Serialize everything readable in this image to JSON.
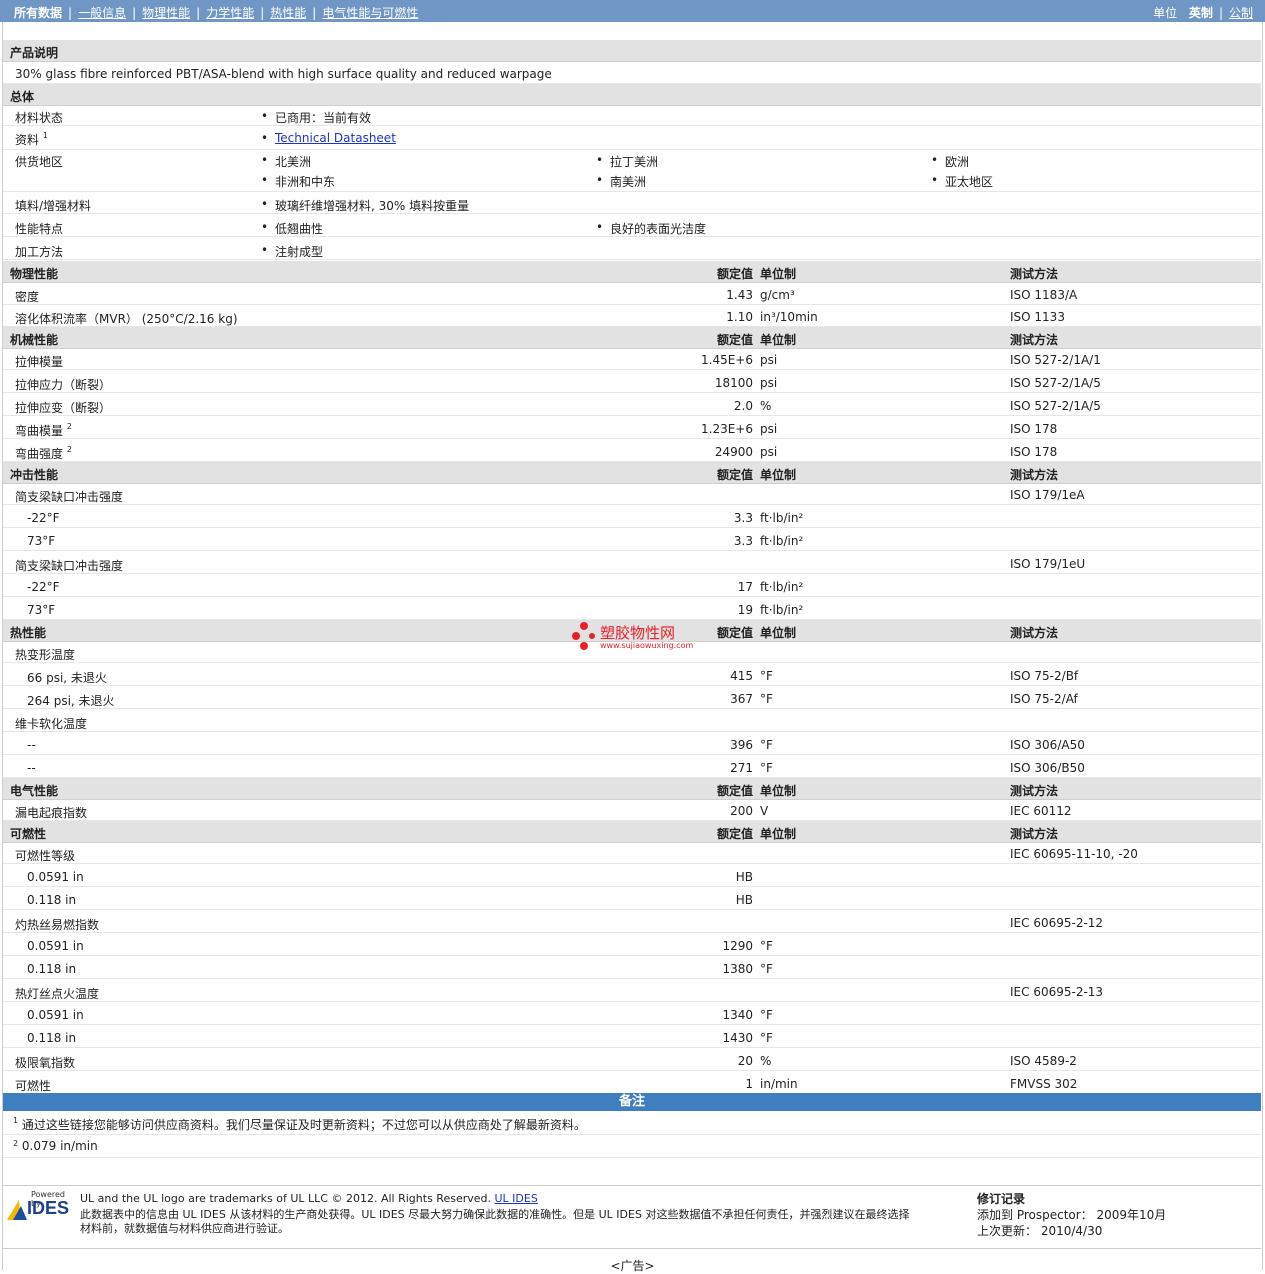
{
  "nav": {
    "items": [
      "所有数据",
      "一般信息",
      "物理性能",
      "力学性能",
      "热性能",
      "电气性能与可燃性"
    ],
    "unit_label": "单位",
    "unit_imperial": "英制",
    "unit_metric": "公制"
  },
  "desc": {
    "title": "产品说明",
    "text": "30% glass fibre reinforced PBT/ASA-blend with high surface quality and reduced warpage"
  },
  "general": {
    "title": "总体",
    "material_status_label": "材料状态",
    "material_status": "已商用：当前有效",
    "resource_label": "资料",
    "resource_sup": "1",
    "resource_link": "Technical Datasheet",
    "regions_label": "供货地区",
    "regions": [
      "北美洲",
      "拉丁美洲",
      "欧洲",
      "非洲和中东",
      "南美洲",
      "亚太地区"
    ],
    "filler_label": "填料/增强材料",
    "filler": "玻璃纤维增强材料, 30% 填料按重量",
    "features_label": "性能特点",
    "features": [
      "低翘曲性",
      "良好的表面光洁度"
    ],
    "processing_label": "加工方法",
    "processing": "注射成型"
  },
  "col": {
    "value": "额定值",
    "unit": "单位制",
    "method": "测试方法"
  },
  "sections": {
    "physical": "物理性能",
    "mechanical": "机械性能",
    "impact": "冲击性能",
    "thermal": "热性能",
    "electrical": "电气性能",
    "flammability": "可燃性"
  },
  "rows": {
    "density": {
      "name": "密度",
      "value": "1.43",
      "unit": "g/cm³",
      "method": "ISO 1183/A"
    },
    "mvr": {
      "name": "溶化体积流率（MVR） (250°C/2.16 kg)",
      "value": "1.10",
      "unit": "in³/10min",
      "method": "ISO 1133"
    },
    "tmod": {
      "name": "拉伸模量",
      "value": "1.45E+6",
      "unit": "psi",
      "method": "ISO 527-2/1A/1"
    },
    "tstress": {
      "name": "拉伸应力（断裂）",
      "value": "18100",
      "unit": "psi",
      "method": "ISO 527-2/1A/5"
    },
    "tstrain": {
      "name": "拉伸应变（断裂）",
      "value": "2.0",
      "unit": "%",
      "method": "ISO 527-2/1A/5"
    },
    "fmod": {
      "name": "弯曲模量",
      "sup": "2",
      "value": "1.23E+6",
      "unit": "psi",
      "method": "ISO 178"
    },
    "fstr": {
      "name": "弯曲强度",
      "sup": "2",
      "value": "24900",
      "unit": "psi",
      "method": "ISO 178"
    },
    "charpy1": {
      "name": "简支梁缺口冲击强度",
      "method": "ISO 179/1eA"
    },
    "c1a": {
      "name": "-22°F",
      "value": "3.3",
      "unit": "ft·lb/in²"
    },
    "c1b": {
      "name": "73°F",
      "value": "3.3",
      "unit": "ft·lb/in²"
    },
    "charpy2": {
      "name": "简支梁缺口冲击强度",
      "method": "ISO 179/1eU"
    },
    "c2a": {
      "name": "-22°F",
      "value": "17",
      "unit": "ft·lb/in²"
    },
    "c2b": {
      "name": "73°F",
      "value": "19",
      "unit": "ft·lb/in²"
    },
    "hdt": {
      "name": "热变形温度"
    },
    "hdt1": {
      "name": "66 psi, 未退火",
      "value": "415",
      "unit": "°F",
      "method": "ISO 75-2/Bf"
    },
    "hdt2": {
      "name": "264 psi, 未退火",
      "value": "367",
      "unit": "°F",
      "method": "ISO 75-2/Af"
    },
    "vicat": {
      "name": "维卡软化温度"
    },
    "v1": {
      "name": "--",
      "value": "396",
      "unit": "°F",
      "method": "ISO 306/A50"
    },
    "v2": {
      "name": "--",
      "value": "271",
      "unit": "°F",
      "method": "ISO 306/B50"
    },
    "cti": {
      "name": "漏电起痕指数",
      "value": "200",
      "unit": "V",
      "method": "IEC 60112"
    },
    "flam": {
      "name": "可燃性等级",
      "method": "IEC 60695-11-10, -20"
    },
    "f1": {
      "name": "0.0591 in",
      "value": "HB"
    },
    "f2": {
      "name": "0.118 in",
      "value": "HB"
    },
    "gwfi": {
      "name": "灼热丝易燃指数",
      "method": "IEC 60695-2-12"
    },
    "g1": {
      "name": "0.0591 in",
      "value": "1290",
      "unit": "°F"
    },
    "g2": {
      "name": "0.118 in",
      "value": "1380",
      "unit": "°F"
    },
    "gwit": {
      "name": "热灯丝点火温度",
      "method": "IEC 60695-2-13"
    },
    "w1": {
      "name": "0.0591 in",
      "value": "1340",
      "unit": "°F"
    },
    "w2": {
      "name": "0.118 in",
      "value": "1430",
      "unit": "°F"
    },
    "loi": {
      "name": "极限氧指数",
      "value": "20",
      "unit": "%",
      "method": "ISO 4589-2"
    },
    "burn": {
      "name": "可燃性",
      "value": "1",
      "unit": "in/min",
      "method": "FMVSS 302"
    }
  },
  "notes": {
    "title": "备注",
    "n1_sup": "1",
    "n1": "通过这些链接您能够访问供应商资料。我们尽量保证及时更新资料；不过您可以从供应商处了解最新资料。",
    "n2_sup": "2",
    "n2": "0.079 in/min"
  },
  "watermark": {
    "title": "塑胶物性网",
    "url": "www.sujiaowuxing.com"
  },
  "footer": {
    "powered": "Powered by",
    "brand": "IDES",
    "line1": "UL and the UL logo are trademarks of UL LLC © 2012. All Rights Reserved.",
    "line1_link": "UL IDES",
    "line2": "此数据表中的信息由 UL IDES 从该材料的生产商处获得。UL IDES 尽最大努力确保此数据的准确性。但是 UL IDES 对这些数据值不承担任何责任，并强烈建议在最终选择",
    "line3": "材料前，就数据值与材料供应商进行验证。",
    "rev_title": "修订记录",
    "rev_added": "添加到 Prospector： 2009年10月",
    "rev_updated": "上次更新： 2010/4/30"
  },
  "ad": "<广告>"
}
